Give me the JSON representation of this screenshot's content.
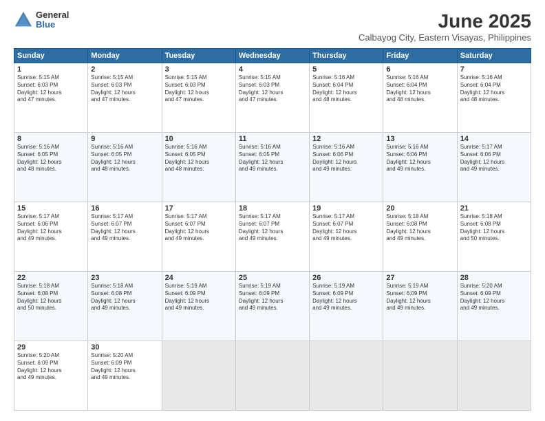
{
  "header": {
    "logo_general": "General",
    "logo_blue": "Blue",
    "month_title": "June 2025",
    "location": "Calbayog City, Eastern Visayas, Philippines"
  },
  "days_header": [
    "Sunday",
    "Monday",
    "Tuesday",
    "Wednesday",
    "Thursday",
    "Friday",
    "Saturday"
  ],
  "weeks": [
    [
      {
        "day": "1",
        "info": "Sunrise: 5:15 AM\nSunset: 6:03 PM\nDaylight: 12 hours\nand 47 minutes."
      },
      {
        "day": "2",
        "info": "Sunrise: 5:15 AM\nSunset: 6:03 PM\nDaylight: 12 hours\nand 47 minutes."
      },
      {
        "day": "3",
        "info": "Sunrise: 5:15 AM\nSunset: 6:03 PM\nDaylight: 12 hours\nand 47 minutes."
      },
      {
        "day": "4",
        "info": "Sunrise: 5:15 AM\nSunset: 6:03 PM\nDaylight: 12 hours\nand 47 minutes."
      },
      {
        "day": "5",
        "info": "Sunrise: 5:16 AM\nSunset: 6:04 PM\nDaylight: 12 hours\nand 48 minutes."
      },
      {
        "day": "6",
        "info": "Sunrise: 5:16 AM\nSunset: 6:04 PM\nDaylight: 12 hours\nand 48 minutes."
      },
      {
        "day": "7",
        "info": "Sunrise: 5:16 AM\nSunset: 6:04 PM\nDaylight: 12 hours\nand 48 minutes."
      }
    ],
    [
      {
        "day": "8",
        "info": "Sunrise: 5:16 AM\nSunset: 6:05 PM\nDaylight: 12 hours\nand 48 minutes."
      },
      {
        "day": "9",
        "info": "Sunrise: 5:16 AM\nSunset: 6:05 PM\nDaylight: 12 hours\nand 48 minutes."
      },
      {
        "day": "10",
        "info": "Sunrise: 5:16 AM\nSunset: 6:05 PM\nDaylight: 12 hours\nand 48 minutes."
      },
      {
        "day": "11",
        "info": "Sunrise: 5:16 AM\nSunset: 6:05 PM\nDaylight: 12 hours\nand 49 minutes."
      },
      {
        "day": "12",
        "info": "Sunrise: 5:16 AM\nSunset: 6:06 PM\nDaylight: 12 hours\nand 49 minutes."
      },
      {
        "day": "13",
        "info": "Sunrise: 5:16 AM\nSunset: 6:06 PM\nDaylight: 12 hours\nand 49 minutes."
      },
      {
        "day": "14",
        "info": "Sunrise: 5:17 AM\nSunset: 6:06 PM\nDaylight: 12 hours\nand 49 minutes."
      }
    ],
    [
      {
        "day": "15",
        "info": "Sunrise: 5:17 AM\nSunset: 6:06 PM\nDaylight: 12 hours\nand 49 minutes."
      },
      {
        "day": "16",
        "info": "Sunrise: 5:17 AM\nSunset: 6:07 PM\nDaylight: 12 hours\nand 49 minutes."
      },
      {
        "day": "17",
        "info": "Sunrise: 5:17 AM\nSunset: 6:07 PM\nDaylight: 12 hours\nand 49 minutes."
      },
      {
        "day": "18",
        "info": "Sunrise: 5:17 AM\nSunset: 6:07 PM\nDaylight: 12 hours\nand 49 minutes."
      },
      {
        "day": "19",
        "info": "Sunrise: 5:17 AM\nSunset: 6:07 PM\nDaylight: 12 hours\nand 49 minutes."
      },
      {
        "day": "20",
        "info": "Sunrise: 5:18 AM\nSunset: 6:08 PM\nDaylight: 12 hours\nand 49 minutes."
      },
      {
        "day": "21",
        "info": "Sunrise: 5:18 AM\nSunset: 6:08 PM\nDaylight: 12 hours\nand 50 minutes."
      }
    ],
    [
      {
        "day": "22",
        "info": "Sunrise: 5:18 AM\nSunset: 6:08 PM\nDaylight: 12 hours\nand 50 minutes."
      },
      {
        "day": "23",
        "info": "Sunrise: 5:18 AM\nSunset: 6:08 PM\nDaylight: 12 hours\nand 49 minutes."
      },
      {
        "day": "24",
        "info": "Sunrise: 5:19 AM\nSunset: 6:09 PM\nDaylight: 12 hours\nand 49 minutes."
      },
      {
        "day": "25",
        "info": "Sunrise: 5:19 AM\nSunset: 6:09 PM\nDaylight: 12 hours\nand 49 minutes."
      },
      {
        "day": "26",
        "info": "Sunrise: 5:19 AM\nSunset: 6:09 PM\nDaylight: 12 hours\nand 49 minutes."
      },
      {
        "day": "27",
        "info": "Sunrise: 5:19 AM\nSunset: 6:09 PM\nDaylight: 12 hours\nand 49 minutes."
      },
      {
        "day": "28",
        "info": "Sunrise: 5:20 AM\nSunset: 6:09 PM\nDaylight: 12 hours\nand 49 minutes."
      }
    ],
    [
      {
        "day": "29",
        "info": "Sunrise: 5:20 AM\nSunset: 6:09 PM\nDaylight: 12 hours\nand 49 minutes."
      },
      {
        "day": "30",
        "info": "Sunrise: 5:20 AM\nSunset: 6:09 PM\nDaylight: 12 hours\nand 49 minutes."
      },
      {
        "day": "",
        "info": ""
      },
      {
        "day": "",
        "info": ""
      },
      {
        "day": "",
        "info": ""
      },
      {
        "day": "",
        "info": ""
      },
      {
        "day": "",
        "info": ""
      }
    ]
  ]
}
